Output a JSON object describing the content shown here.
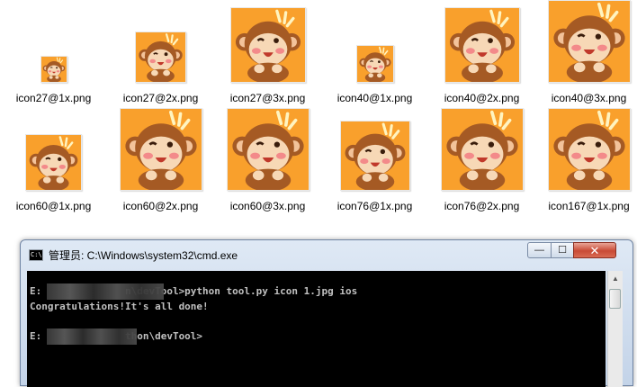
{
  "files": [
    {
      "name": "icon27@1x.png",
      "thumb_icon": "monkey-icon"
    },
    {
      "name": "icon27@2x.png",
      "thumb_icon": "monkey-icon"
    },
    {
      "name": "icon27@3x.png",
      "thumb_icon": "monkey-icon"
    },
    {
      "name": "icon40@1x.png",
      "thumb_icon": "monkey-icon"
    },
    {
      "name": "icon40@2x.png",
      "thumb_icon": "monkey-icon"
    },
    {
      "name": "icon40@3x.png",
      "thumb_icon": "monkey-icon"
    },
    {
      "name": "icon60@1x.png",
      "thumb_icon": "monkey-icon"
    },
    {
      "name": "icon60@2x.png",
      "thumb_icon": "monkey-icon"
    },
    {
      "name": "icon60@3x.png",
      "thumb_icon": "monkey-icon"
    },
    {
      "name": "icon76@1x.png",
      "thumb_icon": "monkey-icon"
    },
    {
      "name": "icon76@2x.png",
      "thumb_icon": "monkey-icon"
    },
    {
      "name": "icon167@1x.png",
      "thumb_icon": "monkey-icon"
    }
  ],
  "cmd_window": {
    "title": "管理员: C:\\Windows\\system32\\cmd.exe",
    "icon_text": "C:\\",
    "buttons": {
      "minimize": "—",
      "maximize": "☐",
      "close": "✕"
    },
    "lines": [
      "E:              n\\devTool>python tool.py icon 1.jpg ios",
      "Congratulations!It's all done!",
      "",
      "E:              thon\\devTool>"
    ]
  },
  "colors": {
    "console_bg": "#000000",
    "console_text": "#c0c0c0",
    "titlebar": "#c3d3e8",
    "close_button": "#c94a35"
  }
}
